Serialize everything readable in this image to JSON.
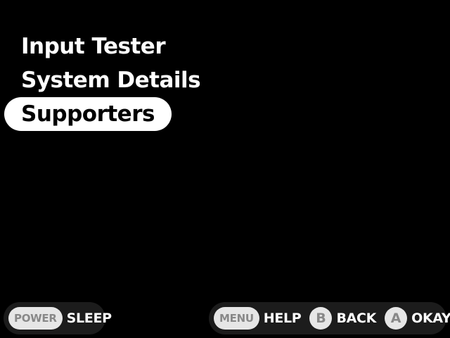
{
  "menu": {
    "items": [
      {
        "label": "Input Tester",
        "selected": false
      },
      {
        "label": "System Details",
        "selected": false
      },
      {
        "label": "Supporters",
        "selected": true
      }
    ]
  },
  "footer": {
    "left": {
      "power": {
        "button": "POWER",
        "action": "SLEEP"
      }
    },
    "right": {
      "menu": {
        "button": "MENU",
        "action": "HELP"
      },
      "b": {
        "button": "B",
        "action": "BACK"
      },
      "a": {
        "button": "A",
        "action": "OKAY"
      }
    }
  },
  "colors": {
    "background": "#000000",
    "text": "#ffffff",
    "selected_bg": "#ffffff",
    "selected_text": "#000000",
    "hint_bg": "#1c1c1c",
    "button_bg": "#e6e6e6",
    "button_text": "#888888"
  }
}
